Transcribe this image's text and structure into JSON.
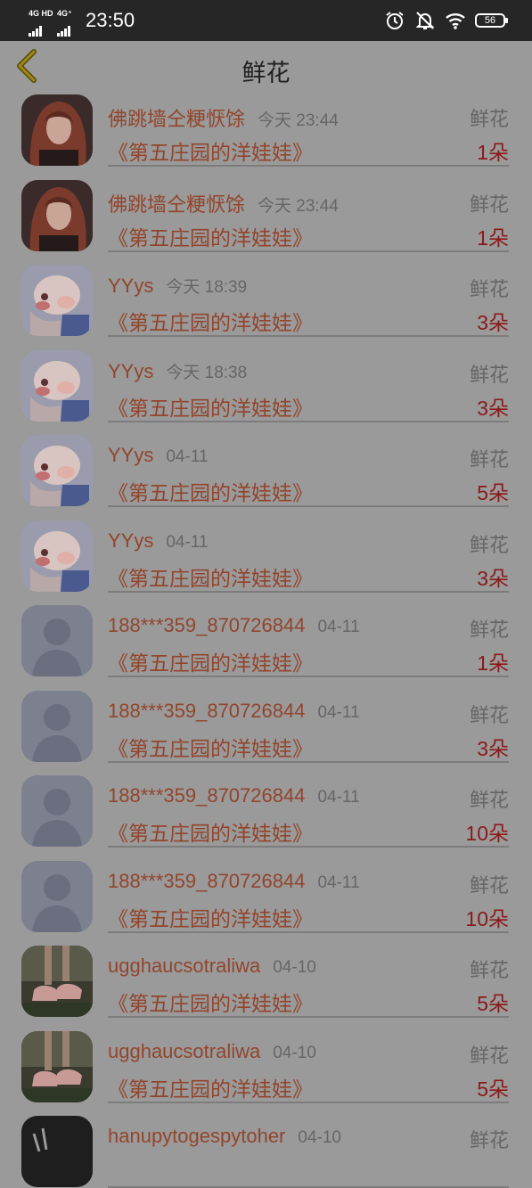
{
  "status_bar": {
    "net1": "4G HD",
    "net2": "4G⁺",
    "time": "23:50",
    "battery": "56"
  },
  "nav": {
    "title": "鲜花"
  },
  "rows": [
    {
      "name": "佛跳墙仝粳恹馀",
      "time": "今天 23:44",
      "kind": "鲜花",
      "book": "《第五庄园的洋娃娃》",
      "count": "1朵",
      "avatar": "portrait-red-hair"
    },
    {
      "name": "佛跳墙仝粳恹馀",
      "time": "今天 23:44",
      "kind": "鲜花",
      "book": "《第五庄园的洋娃娃》",
      "count": "1朵",
      "avatar": "portrait-red-hair"
    },
    {
      "name": "YYys",
      "time": "今天 18:39",
      "kind": "鲜花",
      "book": "《第五庄园的洋娃娃》",
      "count": "3朵",
      "avatar": "pig-cartoon"
    },
    {
      "name": "YYys",
      "time": "今天 18:38",
      "kind": "鲜花",
      "book": "《第五庄园的洋娃娃》",
      "count": "3朵",
      "avatar": "pig-cartoon"
    },
    {
      "name": "YYys",
      "time": "04-11",
      "kind": "鲜花",
      "book": "《第五庄园的洋娃娃》",
      "count": "5朵",
      "avatar": "pig-cartoon"
    },
    {
      "name": "YYys",
      "time": "04-11",
      "kind": "鲜花",
      "book": "《第五庄园的洋娃娃》",
      "count": "3朵",
      "avatar": "pig-cartoon"
    },
    {
      "name": "188***359_870726844",
      "time": "04-11",
      "kind": "鲜花",
      "book": "《第五庄园的洋娃娃》",
      "count": "1朵",
      "avatar": "default-person"
    },
    {
      "name": "188***359_870726844",
      "time": "04-11",
      "kind": "鲜花",
      "book": "《第五庄园的洋娃娃》",
      "count": "3朵",
      "avatar": "default-person"
    },
    {
      "name": "188***359_870726844",
      "time": "04-11",
      "kind": "鲜花",
      "book": "《第五庄园的洋娃娃》",
      "count": "10朵",
      "avatar": "default-person"
    },
    {
      "name": "188***359_870726844",
      "time": "04-11",
      "kind": "鲜花",
      "book": "《第五庄园的洋娃娃》",
      "count": "10朵",
      "avatar": "default-person"
    },
    {
      "name": "ugghaucsotraliwa",
      "time": "04-10",
      "kind": "鲜花",
      "book": "《第五庄园的洋娃娃》",
      "count": "5朵",
      "avatar": "sneakers-photo"
    },
    {
      "name": "ugghaucsotraliwa",
      "time": "04-10",
      "kind": "鲜花",
      "book": "《第五庄园的洋娃娃》",
      "count": "5朵",
      "avatar": "sneakers-photo"
    },
    {
      "name": "hanupytogespytoher",
      "time": "04-10",
      "kind": "鲜花",
      "book": "",
      "count": "",
      "avatar": "dark-photo"
    }
  ]
}
